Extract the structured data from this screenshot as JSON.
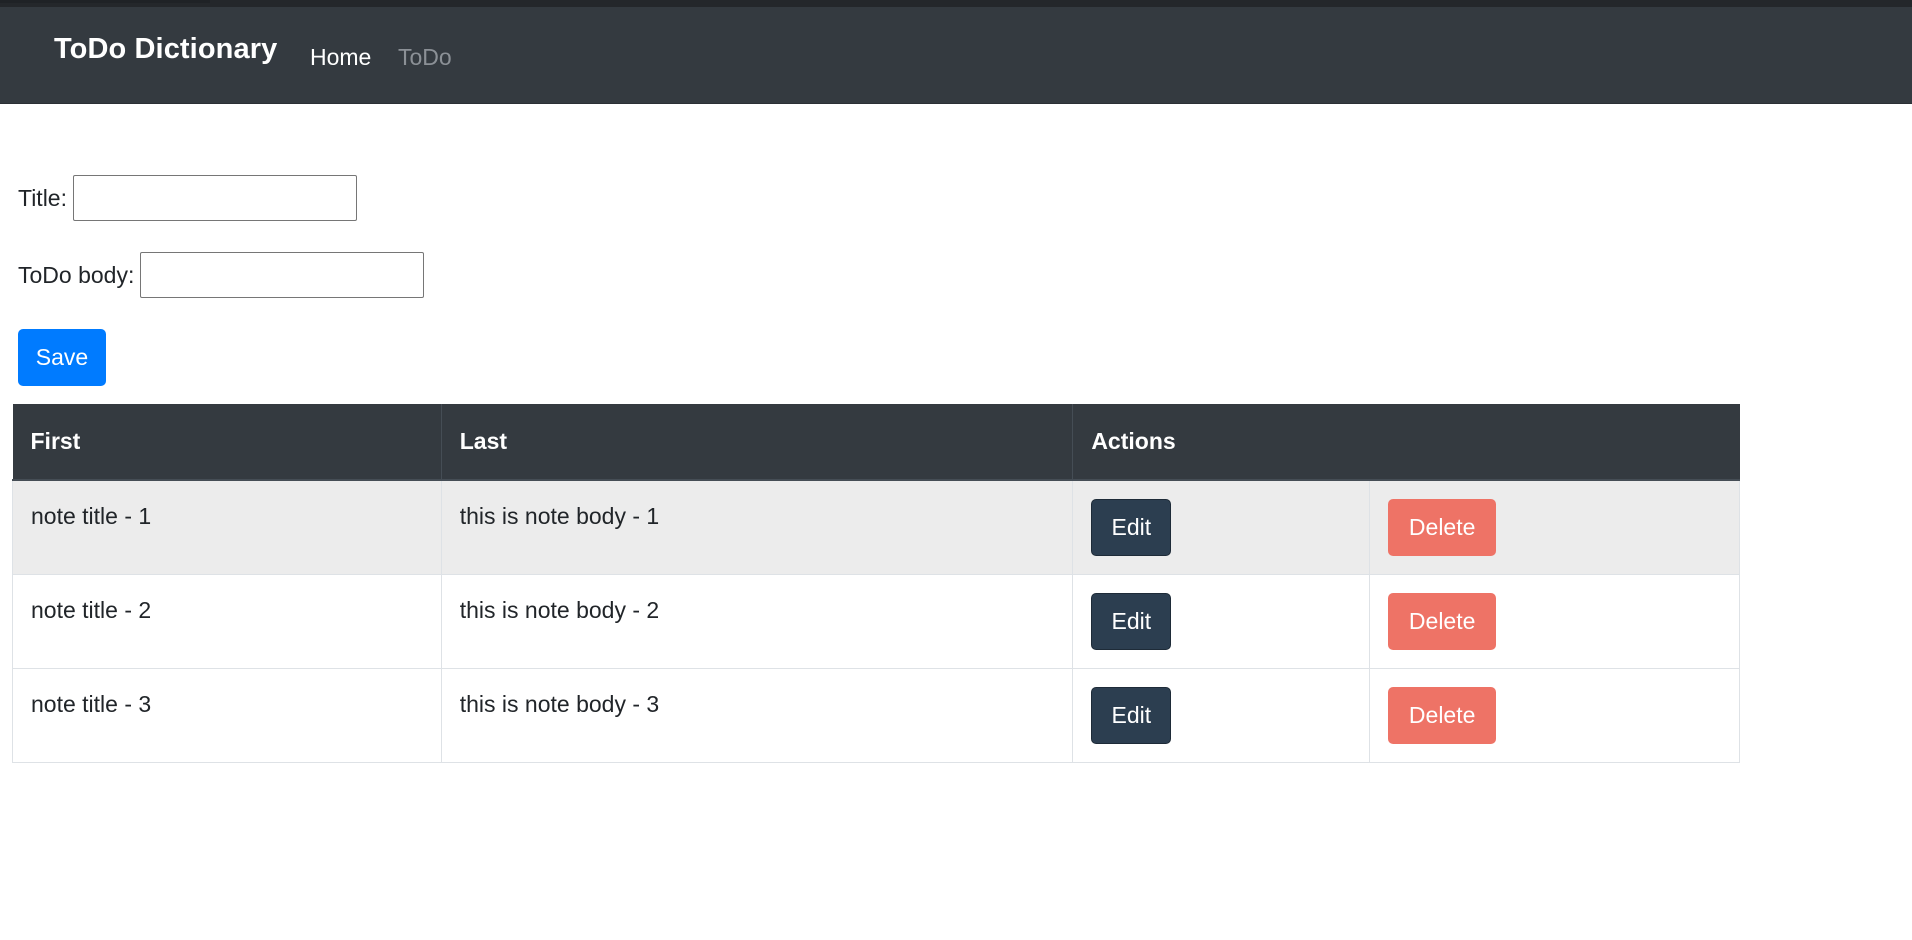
{
  "navbar": {
    "brand": "ToDo Dictionary",
    "links": [
      {
        "label": "Home",
        "active": true
      },
      {
        "label": "ToDo",
        "active": false
      }
    ]
  },
  "form": {
    "title_label": "Title:",
    "title_value": "",
    "body_label": "ToDo body:",
    "body_value": "",
    "save_label": "Save"
  },
  "table": {
    "headers": [
      "First",
      "Last",
      "Actions"
    ],
    "rows": [
      {
        "first": "note title - 1",
        "last": "this is note body - 1"
      },
      {
        "first": "note title - 2",
        "last": "this is note body - 2"
      },
      {
        "first": "note title - 3",
        "last": "this is note body - 3"
      }
    ],
    "edit_label": "Edit",
    "delete_label": "Delete"
  },
  "colors": {
    "navbar": "#343a40",
    "primary": "#007bff",
    "edit": "#2c3e50",
    "delete": "#ee7366"
  }
}
